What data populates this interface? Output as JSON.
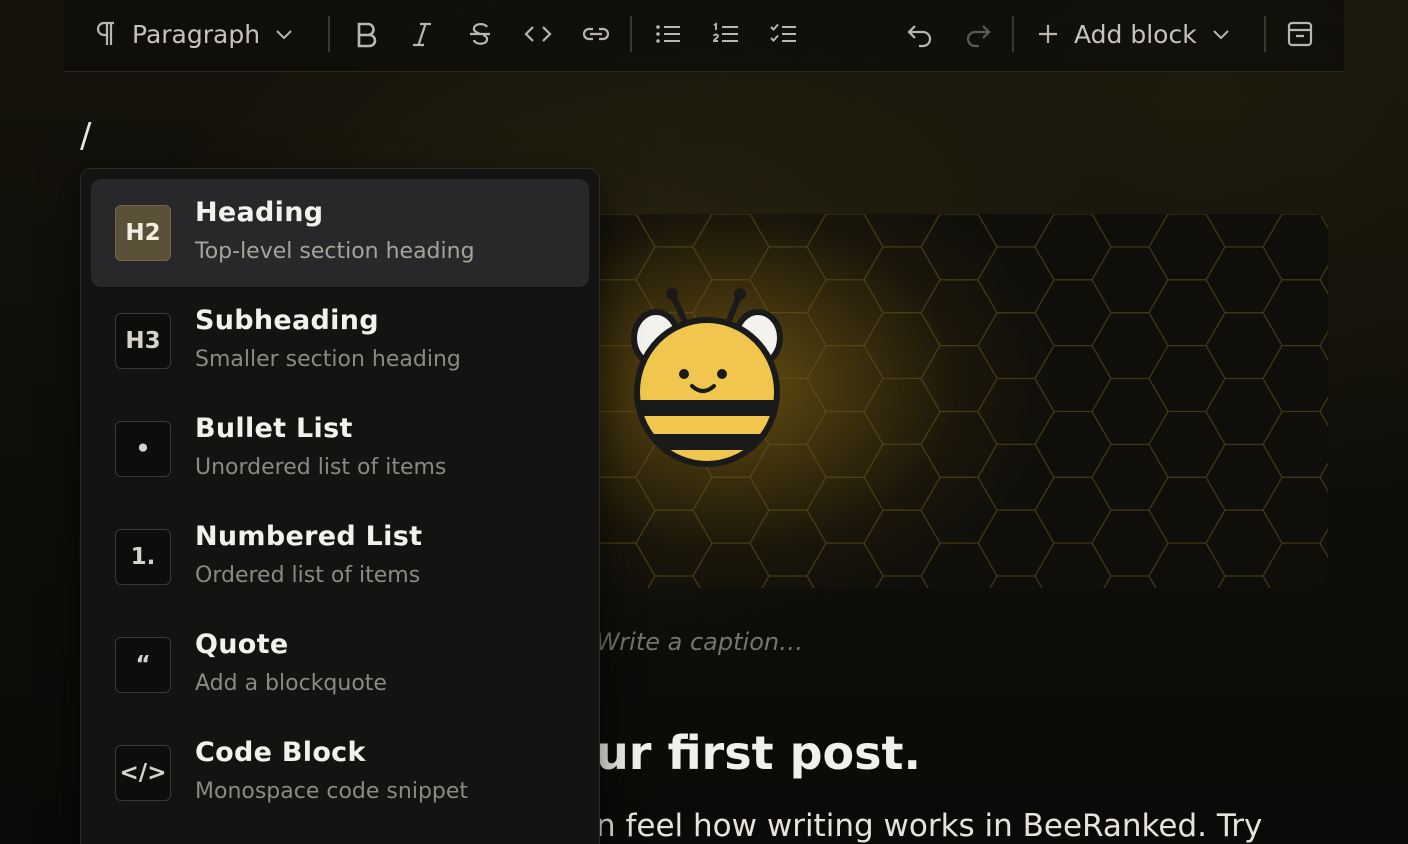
{
  "toolbar": {
    "block_type_label": "Paragraph",
    "add_block_label": "Add block",
    "icons": [
      "paragraph-icon",
      "chevron-down-icon",
      "bold-icon",
      "italic-icon",
      "strikethrough-icon",
      "code-icon",
      "link-icon",
      "bullet-list-icon",
      "numbered-list-icon",
      "checklist-icon",
      "undo-icon",
      "redo-icon",
      "plus-icon",
      "chevron-down-icon",
      "archive-icon"
    ]
  },
  "editor": {
    "slash_text": "/",
    "caption_placeholder": "Write a caption…",
    "post_title_visible": "ur first post.",
    "post_body_visible": "n feel how writing works in BeeRanked. Try"
  },
  "slash_menu": {
    "items": [
      {
        "icon_text": "H2",
        "title": "Heading",
        "description": "Top-level section heading",
        "active": true
      },
      {
        "icon_text": "H3",
        "title": "Subheading",
        "description": "Smaller section heading",
        "active": false
      },
      {
        "icon_text": "•",
        "title": "Bullet List",
        "description": "Unordered list of items",
        "active": false
      },
      {
        "icon_text": "1.",
        "title": "Numbered List",
        "description": "Ordered list of items",
        "active": false
      },
      {
        "icon_text": "“",
        "title": "Quote",
        "description": "Add a blockquote",
        "active": false
      },
      {
        "icon_text": "</>",
        "title": "Code Block",
        "description": "Monospace code snippet",
        "active": false
      }
    ]
  },
  "colors": {
    "background": "#0b0a08",
    "menu_background": "#131312",
    "active_item": "#28282a",
    "accent_gold": "#f0c64e"
  }
}
